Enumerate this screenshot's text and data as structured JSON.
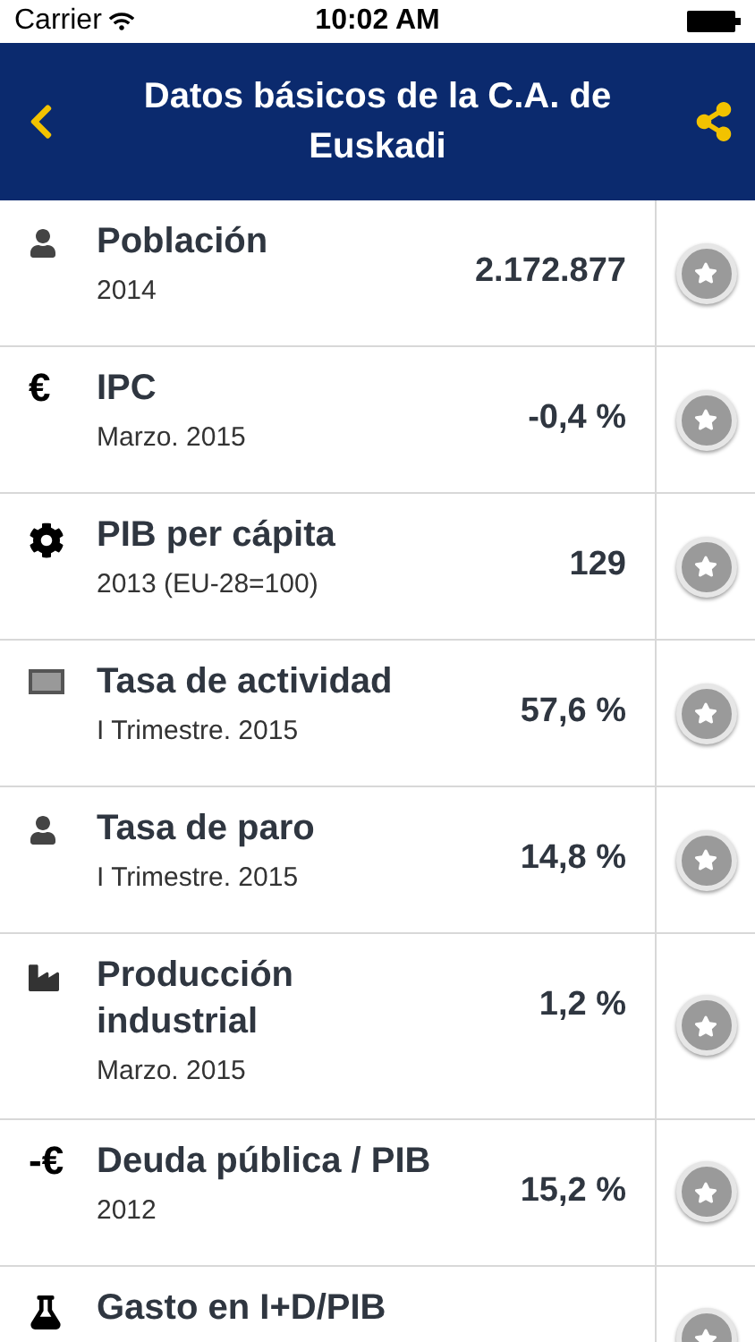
{
  "status_bar": {
    "carrier": "Carrier",
    "time": "10:02 AM"
  },
  "nav": {
    "title": "Datos básicos de la C.A. de Euskadi"
  },
  "rows": [
    {
      "kind": "person",
      "title": "Población",
      "subtitle": "2014",
      "value": "2.172.877"
    },
    {
      "symbol": "€",
      "title": "IPC",
      "subtitle": "Marzo. 2015",
      "value": "-0,4 %"
    },
    {
      "kind": "gear",
      "title": "PIB per cápita",
      "subtitle": "2013 (EU-28=100)",
      "value": "129"
    },
    {
      "kind": "monitor",
      "title": "Tasa de actividad",
      "subtitle": "I Trimestre. 2015",
      "value": "57,6 %"
    },
    {
      "kind": "person",
      "title": "Tasa de paro",
      "subtitle": "I Trimestre. 2015",
      "value": "14,8 %"
    },
    {
      "kind": "factory",
      "title": "Producción industrial",
      "subtitle": "Marzo. 2015",
      "value": "1,2 %"
    },
    {
      "symbol": "-€",
      "title": "Deuda pública / PIB",
      "subtitle": "2012",
      "value": "15,2 %"
    },
    {
      "kind": "flask",
      "title": "Gasto en I+D/PIB"
    }
  ]
}
